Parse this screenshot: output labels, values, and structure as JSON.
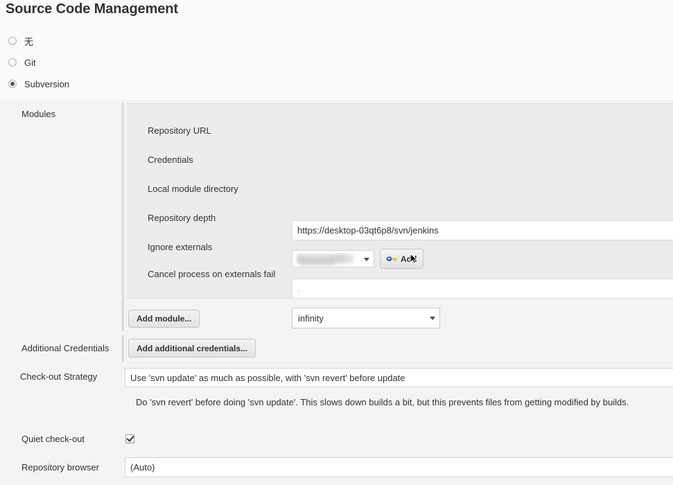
{
  "section": {
    "title": "Source Code Management"
  },
  "scm_options": [
    {
      "label": "无",
      "selected": false,
      "name": "none"
    },
    {
      "label": "Git",
      "selected": false,
      "name": "git"
    },
    {
      "label": "Subversion",
      "selected": true,
      "name": "subversion"
    }
  ],
  "modules": {
    "row_label": "Modules",
    "fields": {
      "repository_url": {
        "label": "Repository URL",
        "value": "https://desktop-03qt6p8/svn/jenkins",
        "placeholder": ""
      },
      "credentials": {
        "label": "Credentials",
        "value": "",
        "add_button": "Add"
      },
      "local_module_directory": {
        "label": "Local module directory",
        "value": ".",
        "placeholder": ""
      },
      "repository_depth": {
        "label": "Repository depth",
        "value": "infinity"
      },
      "ignore_externals": {
        "label": "Ignore externals",
        "checked": true
      },
      "cancel_process_on_externals_fail": {
        "label": "Cancel process on externals fail",
        "checked": true
      }
    },
    "add_module_button": "Add module..."
  },
  "additional_credentials": {
    "label": "Additional Credentials",
    "button": "Add additional credentials..."
  },
  "checkout_strategy": {
    "label": "Check-out Strategy",
    "value": "Use 'svn update' as much as possible, with 'svn revert' before update",
    "help": "Do 'svn revert' before doing 'svn update'. This slows down builds a bit, but this prevents files from getting modified by builds."
  },
  "quiet_checkout": {
    "label": "Quiet check-out",
    "checked": true
  },
  "repository_browser": {
    "label": "Repository browser",
    "value": "(Auto)"
  },
  "colors": {
    "page_background": "#fbfbfb",
    "row_background": "#f4f4f4",
    "panel_background": "#ececec",
    "text": "#333333",
    "input_background": "#ffffff",
    "border": "#d6d6d6"
  }
}
